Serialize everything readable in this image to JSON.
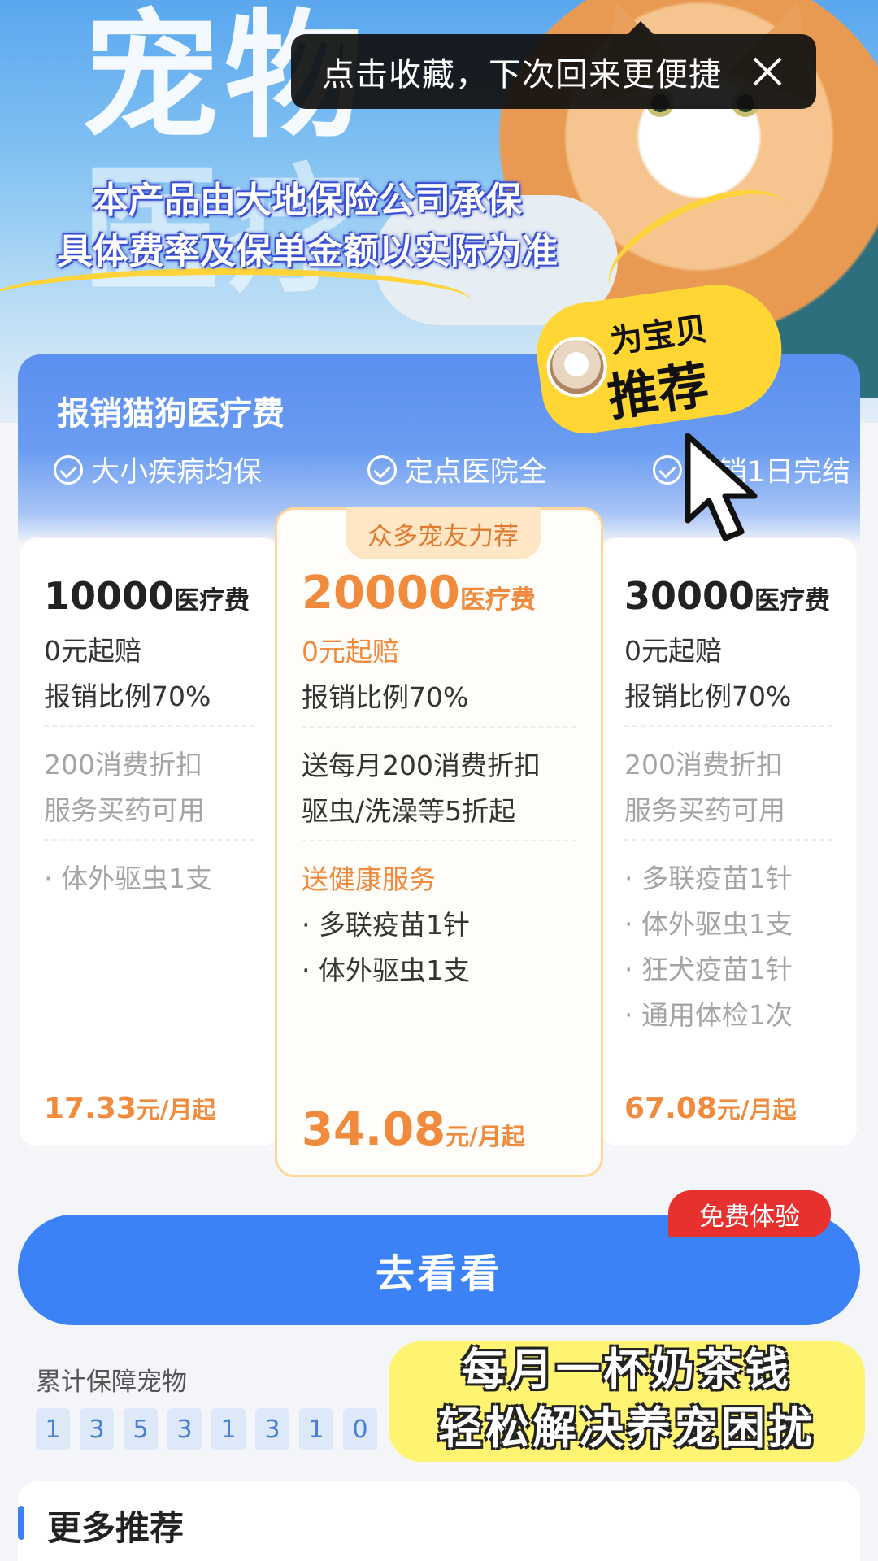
{
  "hero": {
    "title_line1": "宠物",
    "title_line2": "医疗",
    "disclaimer_line1": "本产品由大地保险公司承保",
    "disclaimer_line2": "具体费率及保单金额以实际为准"
  },
  "tooltip": {
    "text": "点击收藏，下次回来更便捷",
    "close_icon": "close-icon"
  },
  "panel": {
    "title": "报销猫狗医疗费",
    "features": [
      "大小疾病均保",
      "定点医院全",
      "报销1日完结"
    ]
  },
  "sticker": {
    "small": "为宝贝",
    "big": "推荐"
  },
  "plans": {
    "left": {
      "amount": "10000",
      "amount_unit": "医疗费",
      "deductible": "0元起赔",
      "ratio": "报销比例70%",
      "discount_line1": "200消费折扣",
      "discount_line2": "服务买药可用",
      "services": [
        "· 体外驱虫1支"
      ],
      "price": "17.33",
      "price_unit": "元/月起"
    },
    "mid": {
      "tag": "众多宠友力荐",
      "amount": "20000",
      "amount_unit": "医疗费",
      "deductible": "0元起赔",
      "ratio": "报销比例70%",
      "discount_line1": "送每月200消费折扣",
      "discount_line2": "驱虫/洗澡等5折起",
      "services_title": "送健康服务",
      "services": [
        "· 多联疫苗1针",
        "· 体外驱虫1支"
      ],
      "price": "34.08",
      "price_unit": "元/月起"
    },
    "right": {
      "amount": "30000",
      "amount_unit": "医疗费",
      "deductible": "0元起赔",
      "ratio": "报销比例70%",
      "discount_line1": "200消费折扣",
      "discount_line2": "服务买药可用",
      "services": [
        "· 多联疫苗1针",
        "· 体外驱虫1支",
        "· 狂犬疫苗1针",
        "· 通用体检1次"
      ],
      "price": "67.08",
      "price_unit": "元/月起"
    }
  },
  "cta": {
    "label": "去看看",
    "badge": "免费体验"
  },
  "counter": {
    "label": "累计保障宠物",
    "digits": [
      "1",
      "3",
      "5",
      "3",
      "1",
      "3",
      "1",
      "0"
    ]
  },
  "caption": {
    "line1": "每月一杯奶茶钱",
    "line2": "轻松解决养宠困扰"
  },
  "more": {
    "title": "更多推荐"
  },
  "colors": {
    "accent_blue": "#3b82f6",
    "accent_orange": "#f08a3c",
    "badge_red": "#e8302f",
    "sticker_yellow": "#ffd633"
  }
}
